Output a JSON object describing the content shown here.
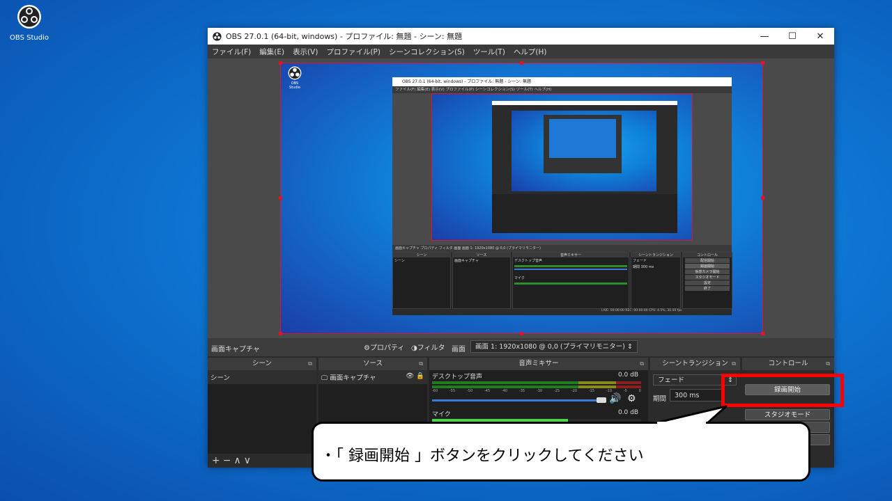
{
  "desktop": {
    "icon_label": "OBS Studio"
  },
  "window": {
    "title": "OBS 27.0.1 (64-bit, windows) - プロファイル: 無題 - シーン: 無題",
    "controls": {
      "minimize": "—",
      "maximize": "☐",
      "close": "✕"
    }
  },
  "menubar": [
    "ファイル(F)",
    "編集(E)",
    "表示(V)",
    "プロファイル(P)",
    "シーンコレクション(S)",
    "ツール(T)",
    "ヘルプ(H)"
  ],
  "nested": {
    "title": "OBS 27.0.1 (64-bit, windows) - プロファイル: 無題 - シーン: 無題",
    "menu": "ファイル(F)  編集(E)  表示(V)  プロファイル(P)  シーンコレクション(S)  ツール(T)  ヘルプ(H)",
    "source_bar": "画面キャプチャ        プロパティ  フィルタ   画面  画面 1: 1920x1080 @ 0,0 (プライマリモニター)",
    "scene_head": "シーン",
    "source_head": "ソース",
    "mixer_head": "音声ミキサー",
    "transition_head": "シーントランジション",
    "control_head": "コントロール",
    "scene_item": "シーン",
    "source_item": "画面キャプチャ",
    "desktop_audio": "デスクトップ音声",
    "mic": "マイク",
    "fade": "フェード",
    "duration_label": "期間",
    "duration": "300 ms",
    "controls": [
      "配信開始",
      "録画開始",
      "仮想カメラ開始",
      "スタジオモード",
      "設定",
      "終了"
    ],
    "status": "LIVE: 00:00:00   REC: 00:00:00   CPU: 4.5%, 30.00 fps"
  },
  "source_bar": {
    "label": "画面キャプチャ",
    "properties": "プロパティ",
    "filters": "フィルタ",
    "display_label": "画面",
    "display_value": "画面 1: 1920x1080 @ 0,0 (プライマリモニター)"
  },
  "docks": {
    "scenes": {
      "title": "シーン",
      "items": [
        "シーン"
      ]
    },
    "sources": {
      "title": "ソース",
      "items": [
        "画面キャプチャ"
      ]
    },
    "mixer": {
      "title": "音声ミキサー",
      "tracks": [
        {
          "name": "デスクトップ音声",
          "db": "0.0 dB"
        },
        {
          "name": "マイク",
          "db": "0.0 dB"
        }
      ],
      "ticks": [
        "-60",
        "-55",
        "-50",
        "-45",
        "-40",
        "-35",
        "-30",
        "-25",
        "-20",
        "-15",
        "-10",
        "-5",
        "0"
      ]
    },
    "transitions": {
      "title": "シーントランジション",
      "fade": "フェード",
      "duration_label": "期間",
      "duration": "300 ms"
    },
    "controls": {
      "title": "コントロール",
      "record": "録画開始",
      "studio": "スタジオモード"
    }
  },
  "callout": {
    "text": "・「 録画開始 」ボタンをクリックしてください"
  },
  "colors": {
    "highlight": "#ff0000",
    "accent": "#3a7bd5"
  }
}
